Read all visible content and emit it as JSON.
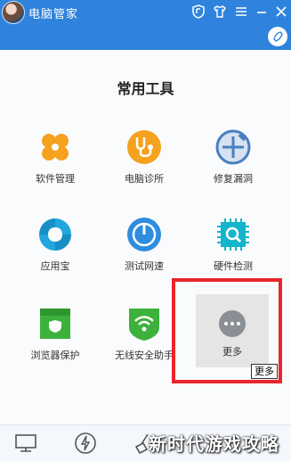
{
  "app": {
    "title": "电脑管家"
  },
  "section": {
    "title": "常用工具"
  },
  "tools": [
    {
      "label": "软件管理",
      "icon": "software-manager-icon",
      "color": "#f6a21e"
    },
    {
      "label": "电脑诊所",
      "icon": "computer-clinic-icon",
      "color": "#f6a21e"
    },
    {
      "label": "修复漏洞",
      "icon": "repair-vulnerability-icon",
      "color": "#4a7fc0"
    },
    {
      "label": "应用宝",
      "icon": "app-store-icon",
      "color": "#21a6dd"
    },
    {
      "label": "测试网速",
      "icon": "speed-test-icon",
      "color": "#2f8ddf"
    },
    {
      "label": "硬件检测",
      "icon": "hardware-check-icon",
      "color": "#12b5c9"
    },
    {
      "label": "浏览器保护",
      "icon": "browser-protect-icon",
      "color": "#3cb13c"
    },
    {
      "label": "无线安全助手",
      "icon": "wifi-security-icon",
      "color": "#3cb13c"
    }
  ],
  "more": {
    "label": "更多",
    "tooltip": "更多"
  },
  "watermark": "新时代游戏攻略"
}
